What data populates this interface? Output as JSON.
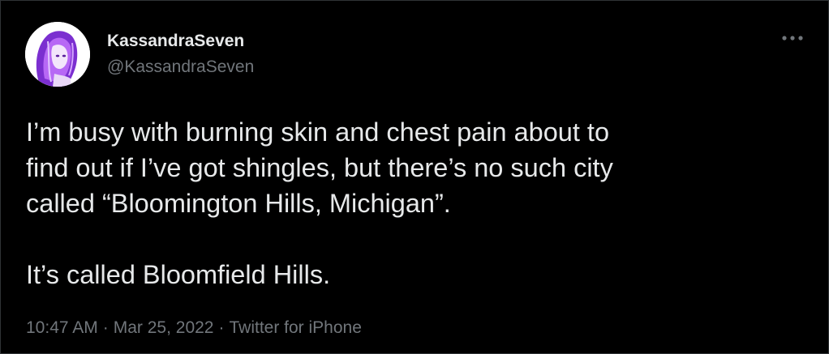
{
  "author": {
    "display_name": "KassandraSeven",
    "handle": "@KassandraSeven"
  },
  "tweet": {
    "lines_paragraph_1": [
      "I’m busy with burning skin and chest pain about to",
      "find out if I’ve got shingles, but there’s no such city",
      "called “Bloomington Hills, Michigan”."
    ],
    "paragraph_2": "It’s called Bloomfield Hills."
  },
  "meta": {
    "time": "10:47 AM",
    "separator": "·",
    "date": "Mar 25, 2022",
    "source": "Twitter for iPhone"
  },
  "icons": {
    "more": "more-horizontal-icon"
  },
  "colors": {
    "background": "#000000",
    "text_primary": "#e7e9ea",
    "text_secondary": "#71767b",
    "border": "#2f3336",
    "avatar_accent": "#9a3ee0"
  }
}
